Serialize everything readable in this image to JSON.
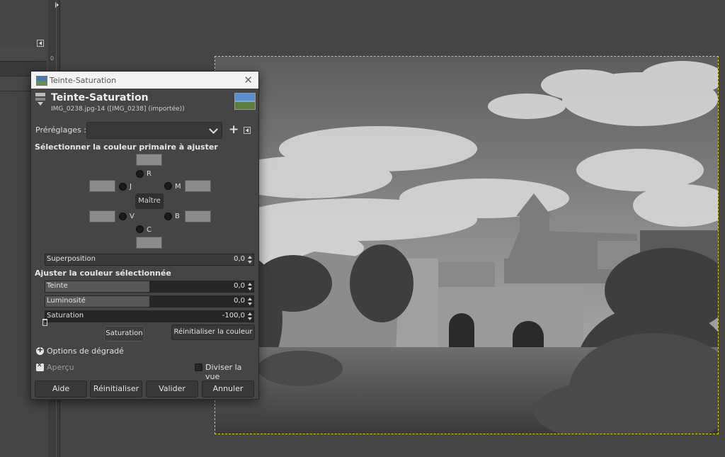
{
  "ruler": {
    "zero_label": "0"
  },
  "dialog": {
    "window_title": "Teinte-Saturation",
    "header_title": "Teinte-Saturation",
    "header_subtitle": "IMG_0238.jpg-14 ([IMG_0238] (importée))",
    "presets_label": "Préréglages :",
    "presets_value": "",
    "primary_section_title": "Sélectionner la couleur primaire à ajuster",
    "primary_colors": {
      "R": "R",
      "J": "J",
      "M": "M",
      "V": "V",
      "B": "B",
      "C": "C",
      "master": "Maître"
    },
    "overlap": {
      "label": "Superposition",
      "value": "0,0"
    },
    "adjust_section_title": "Ajuster la couleur sélectionnée",
    "sliders": [
      {
        "label": "Teinte",
        "value": "0,0",
        "level": 0.5
      },
      {
        "label": "Luminosité",
        "value": "0,0",
        "level": 0.5
      },
      {
        "label": "Saturation",
        "value": "-100,0",
        "level": 0.0
      }
    ],
    "saturation_button": "Saturation",
    "reset_color_button": "Réinitialiser la couleur",
    "gradient_options": "Options de dégradé",
    "preview": {
      "label": "Aperçu",
      "checked": true
    },
    "split_view": {
      "label": "Diviser la vue",
      "checked": false
    },
    "footer": {
      "help": "Aide",
      "reset": "Réinitialiser",
      "ok": "Valider",
      "cancel": "Annuler"
    }
  }
}
